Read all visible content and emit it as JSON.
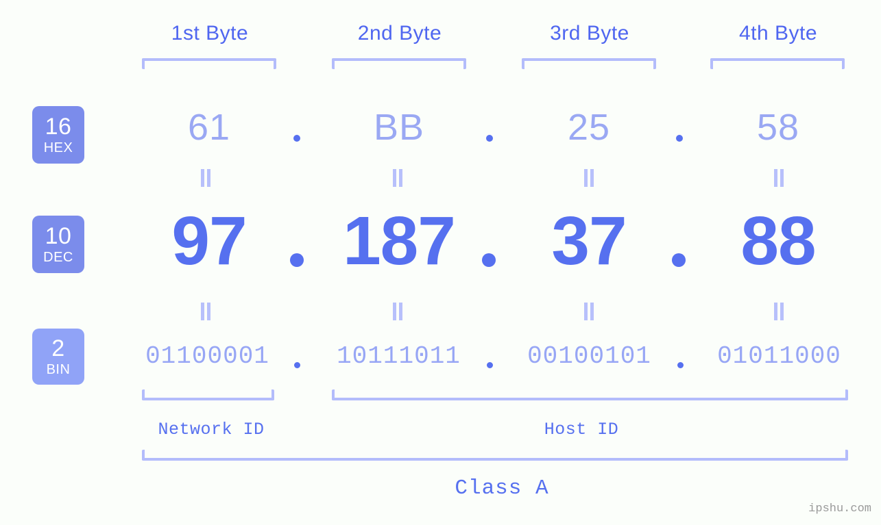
{
  "watermark": "ipshu.com",
  "colors": {
    "background": "#fbfefa",
    "accent_blue": "#5670ef",
    "light_blue": "#b3bcfb",
    "badge_blue": "#7b8ceb",
    "badge_blue_light": "#90a3f7",
    "hex_text": "#9aa8f3",
    "bin_text": "#97a6f5",
    "watermark_gray": "#9a9a9a"
  },
  "byte_headers": [
    {
      "label": "1st Byte"
    },
    {
      "label": "2nd Byte"
    },
    {
      "label": "3rd Byte"
    },
    {
      "label": "4th Byte"
    }
  ],
  "bases": [
    {
      "number": "16",
      "name": "HEX"
    },
    {
      "number": "10",
      "name": "DEC"
    },
    {
      "number": "2",
      "name": "BIN"
    }
  ],
  "separator": ".",
  "equals_symbol": "=",
  "rows": {
    "hex": {
      "base": "16",
      "name": "HEX",
      "values": [
        "61",
        "BB",
        "25",
        "58"
      ]
    },
    "dec": {
      "base": "10",
      "name": "DEC",
      "values": [
        "97",
        "187",
        "37",
        "88"
      ]
    },
    "bin": {
      "base": "2",
      "name": "BIN",
      "values": [
        "01100001",
        "10111011",
        "00100101",
        "01011000"
      ]
    }
  },
  "sections": [
    {
      "label": "Network ID"
    },
    {
      "label": "Host ID"
    }
  ],
  "class": {
    "label": "Class A"
  },
  "chart_data": {
    "type": "table",
    "title": "IP address byte breakdown",
    "ip_address": "97.187.37.88",
    "ip_class": "Class A",
    "columns": [
      "1st Byte",
      "2nd Byte",
      "3rd Byte",
      "4th Byte"
    ],
    "rows": [
      {
        "base": 16,
        "name": "HEX",
        "values": [
          "61",
          "BB",
          "25",
          "58"
        ]
      },
      {
        "base": 10,
        "name": "DEC",
        "values": [
          "97",
          "187",
          "37",
          "88"
        ]
      },
      {
        "base": 2,
        "name": "BIN",
        "values": [
          "01100001",
          "10111011",
          "00100101",
          "01011000"
        ]
      }
    ],
    "network_id_bytes": [
      "1st Byte"
    ],
    "host_id_bytes": [
      "2nd Byte",
      "3rd Byte",
      "4th Byte"
    ]
  }
}
